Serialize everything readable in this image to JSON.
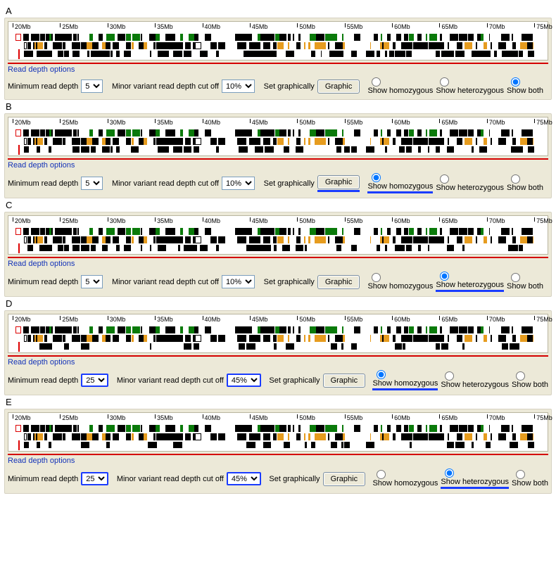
{
  "ruler_labels": [
    "20Mb",
    "25Mb",
    "30Mb",
    "35Mb",
    "40Mb",
    "45Mb",
    "50Mb",
    "55Mb",
    "60Mb",
    "65Mb",
    "70Mb",
    "75Mb"
  ],
  "opts": {
    "min_depth_label": "Minimum read depth",
    "minor_label": "Minor variant read depth cut off",
    "set_graph_label": "Set graphically",
    "graphic_btn": "Graphic",
    "show_homo": "Show homozygous",
    "show_het": "Show heterozygous",
    "show_both": "Show both",
    "section_title": "Read depth options"
  },
  "panels": [
    {
      "id": "A",
      "min_depth": "5",
      "minor": "10%",
      "radio": "both",
      "hl": []
    },
    {
      "id": "B",
      "min_depth": "5",
      "minor": "10%",
      "radio": "homo",
      "hl": [
        "homo",
        "btn"
      ]
    },
    {
      "id": "C",
      "min_depth": "5",
      "minor": "10%",
      "radio": "het",
      "hl": [
        "het"
      ]
    },
    {
      "id": "D",
      "min_depth": "25",
      "minor": "45%",
      "radio": "homo",
      "hl": [
        "min",
        "minor",
        "homo"
      ]
    },
    {
      "id": "E",
      "min_depth": "25",
      "minor": "45%",
      "radio": "het",
      "hl": [
        "min",
        "minor",
        "het"
      ]
    }
  ]
}
